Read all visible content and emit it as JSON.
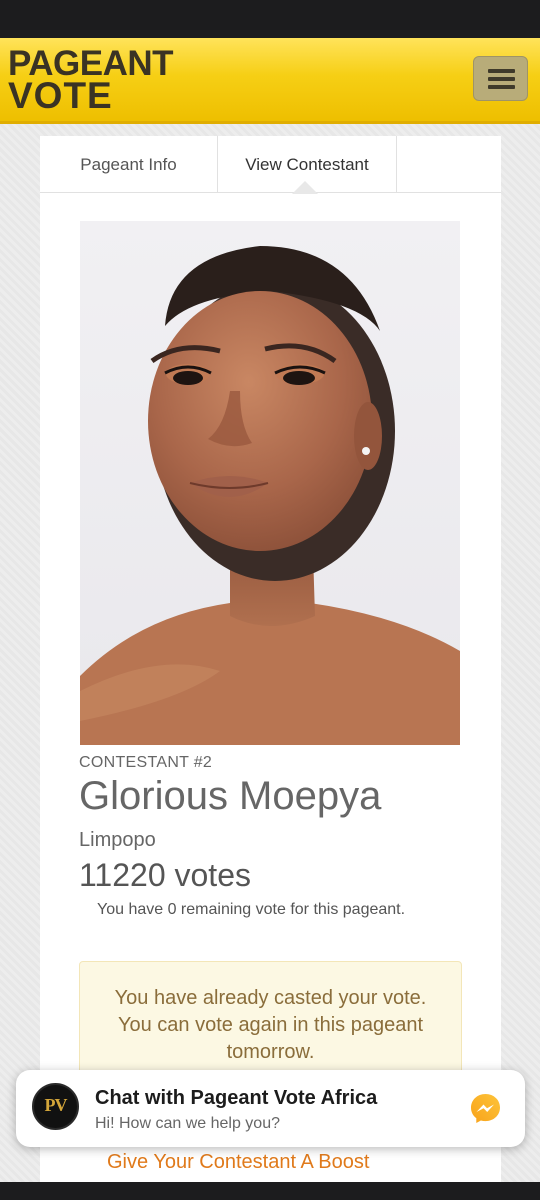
{
  "header": {
    "logo_line1": "PAGEANT",
    "logo_line2": "VOTE",
    "menu_icon": "hamburger-menu-icon",
    "brand_color": "#f5cd11"
  },
  "tabs": [
    {
      "label": "Pageant Info",
      "active": false
    },
    {
      "label": "View Contestant",
      "active": true
    }
  ],
  "contestant": {
    "number_label": "CONTESTANT #2",
    "name": "Glorious Moepya",
    "region": "Limpopo",
    "votes": "11220 votes",
    "remaining_note": "You have 0 remaining vote for this pageant."
  },
  "alert": {
    "line1": "You have already casted your vote.",
    "line2": "You can vote again in this pageant",
    "line3": "tomorrow."
  },
  "boost_link": "Give Your Contestant A Boost",
  "chat": {
    "avatar_text": "PV",
    "title": "Chat with Pageant Vote Africa",
    "subtitle": "Hi! How can we help you?",
    "icon": "messenger-icon"
  },
  "colors": {
    "alert_bg": "#fcf8e3",
    "alert_text": "#8a6d3b",
    "link": "#e07a1b"
  }
}
